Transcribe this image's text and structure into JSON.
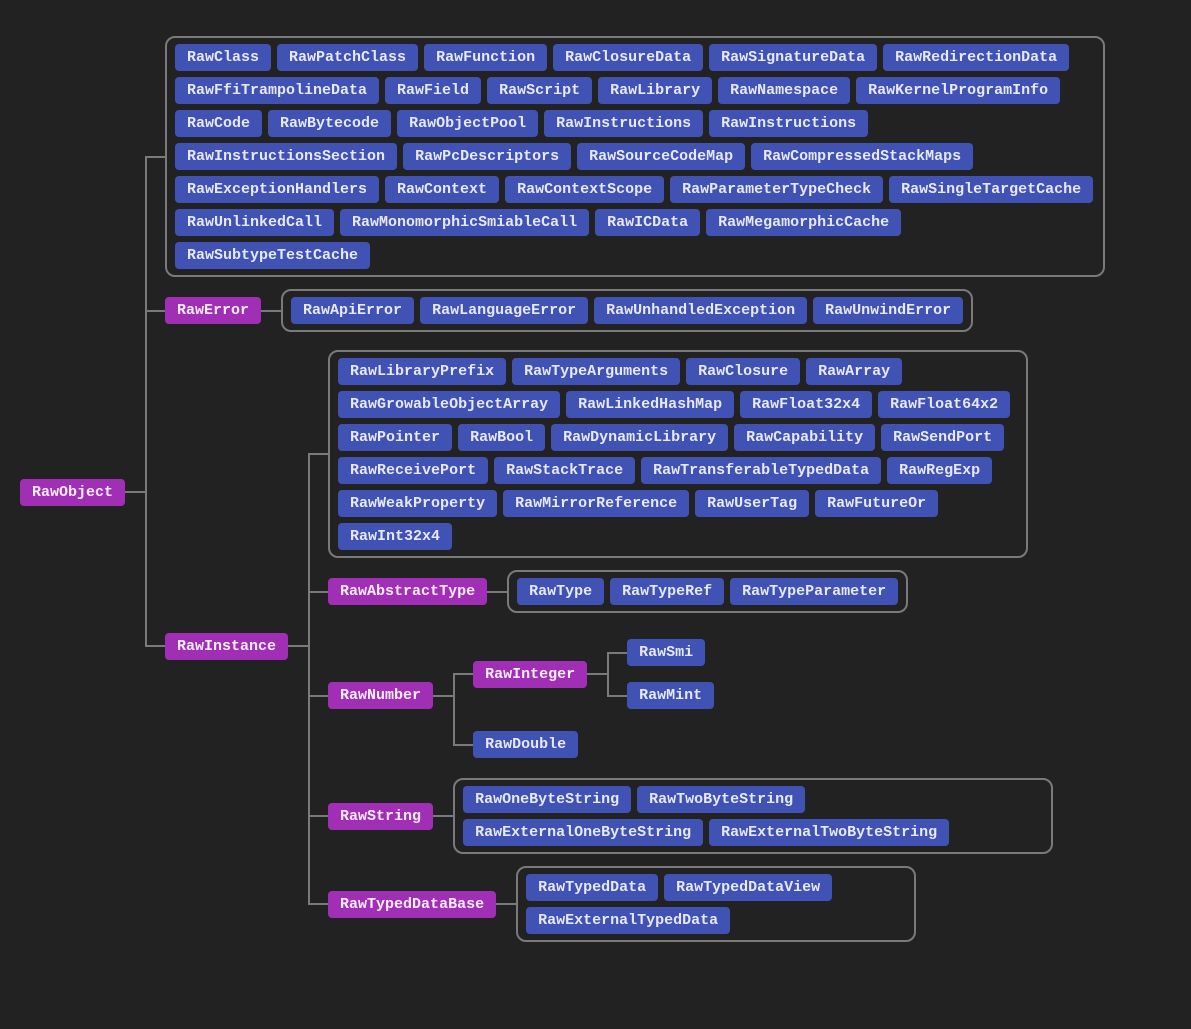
{
  "root": "RawObject",
  "colors": {
    "parent": "#a02fb5",
    "leaf": "#4152b5",
    "connector": "#7a7a7a",
    "bg": "#222222"
  },
  "object_direct_leaves": [
    "RawClass",
    "RawPatchClass",
    "RawFunction",
    "RawClosureData",
    "RawSignatureData",
    "RawRedirectionData",
    "RawFfiTrampolineData",
    "RawField",
    "RawScript",
    "RawLibrary",
    "RawNamespace",
    "RawKernelProgramInfo",
    "RawCode",
    "RawBytecode",
    "RawObjectPool",
    "RawInstructions",
    "RawInstructions",
    "RawInstructionsSection",
    "RawPcDescriptors",
    "RawSourceCodeMap",
    "RawCompressedStackMaps",
    "RawExceptionHandlers",
    "RawContext",
    "RawContextScope",
    "RawParameterTypeCheck",
    "RawSingleTargetCache",
    "RawUnlinkedCall",
    "RawMonomorphicSmiableCall",
    "RawICData",
    "RawMegamorphicCache",
    "RawSubtypeTestCache"
  ],
  "error": {
    "label": "RawError",
    "children": [
      "RawApiError",
      "RawLanguageError",
      "RawUnhandledException",
      "RawUnwindError"
    ]
  },
  "instance": {
    "label": "RawInstance",
    "direct_leaves": [
      "RawLibraryPrefix",
      "RawTypeArguments",
      "RawClosure",
      "RawArray",
      "RawGrowableObjectArray",
      "RawLinkedHashMap",
      "RawFloat32x4",
      "RawFloat64x2",
      "RawPointer",
      "RawBool",
      "RawDynamicLibrary",
      "RawCapability",
      "RawSendPort",
      "RawReceivePort",
      "RawStackTrace",
      "RawTransferableTypedData",
      "RawRegExp",
      "RawWeakProperty",
      "RawMirrorReference",
      "RawUserTag",
      "RawFutureOr",
      "RawInt32x4"
    ],
    "abstract_type": {
      "label": "RawAbstractType",
      "children": [
        "RawType",
        "RawTypeRef",
        "RawTypeParameter"
      ]
    },
    "number": {
      "label": "RawNumber",
      "integer": {
        "label": "RawInteger",
        "children": [
          "RawSmi",
          "RawMint"
        ]
      },
      "double": "RawDouble"
    },
    "string": {
      "label": "RawString",
      "children": [
        "RawOneByteString",
        "RawTwoByteString",
        "RawExternalOneByteString",
        "RawExternalTwoByteString"
      ]
    },
    "typed": {
      "label": "RawTypedDataBase",
      "children": [
        "RawTypedData",
        "RawTypedDataView",
        "RawExternalTypedData"
      ]
    }
  }
}
